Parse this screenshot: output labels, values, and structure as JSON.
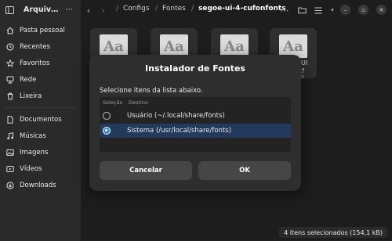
{
  "sidebar": {
    "title": "Arquiv…",
    "items": [
      {
        "label": "Pasta pessoal",
        "icon": "home-icon"
      },
      {
        "label": "Recentes",
        "icon": "clock-icon"
      },
      {
        "label": "Favoritos",
        "icon": "star-icon"
      },
      {
        "label": "Rede",
        "icon": "network-icon"
      },
      {
        "label": "Lixeira",
        "icon": "trash-icon"
      },
      {
        "label": "Documentos",
        "icon": "document-icon"
      },
      {
        "label": "Músicas",
        "icon": "music-icon"
      },
      {
        "label": "Imagens",
        "icon": "image-icon"
      },
      {
        "label": "Vídeos",
        "icon": "video-icon"
      },
      {
        "label": "Downloads",
        "icon": "download-icon"
      }
    ]
  },
  "path": {
    "crumbs": [
      "Configs",
      "Fontes",
      "segoe-ui-4-cufonfonts"
    ]
  },
  "thumbnails": {
    "glyph": "Aa",
    "partial_label_1": "UI",
    "partial_label_2": "tf",
    "partial_label_3": "8"
  },
  "dialog": {
    "title": "Instalador de Fontes",
    "subtitle": "Selecione itens da lista abaixo.",
    "col_selection": "Seleção",
    "col_destination": "Destino",
    "options": [
      {
        "label": "Usuário (~/.local/share/fonts)",
        "selected": false
      },
      {
        "label": "Sistema (/usr/local/share/fonts)",
        "selected": true
      }
    ],
    "cancel_label": "Cancelar",
    "ok_label": "OK"
  },
  "status": {
    "text": "4 itens selecionados (154,1 kB)"
  },
  "colors": {
    "accent": "#3584e4",
    "selection_row": "#233a5c",
    "dialog_bg": "#2e2e2e"
  }
}
